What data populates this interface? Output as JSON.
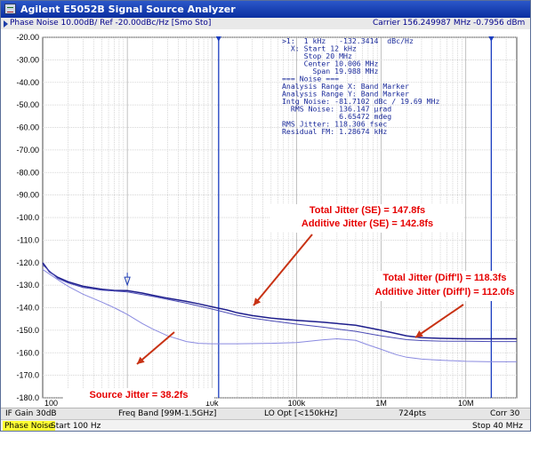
{
  "window": {
    "title": "Agilent E5052B Signal Source Analyzer"
  },
  "trace_header": {
    "label": "Phase Noise 10.00dB/ Ref -20.00dBc/Hz [Smo Sto]",
    "carrier": "Carrier 156.249987 MHz    -0.7956 dBm"
  },
  "marker_readout": [
    ">1:  1 kHz   -132.3414  dBc/Hz",
    "  X: Start 12 kHz",
    "     Stop 20 MHz",
    "     Center 10.006 MHz",
    "       Span 19.988 MHz",
    "=== Noise ===",
    "Analysis Range X: Band Marker",
    "Analysis Range Y: Band Marker",
    "Intg Noise: -81.7102 dBc / 19.69 MHz",
    "  RMS Noise: 136.147 µrad",
    "             6.65472 mdeg",
    "RMS Jitter: 118.306 fsec",
    "Residual FM: 1.28674 kHz"
  ],
  "annotations": {
    "se_1": "Total Jitter (SE) = 147.8fs",
    "se_2": "Additive Jitter (SE) = 142.8fs",
    "diff_1": "Total Jitter (Diff'l) = 118.3fs",
    "diff_2": "Additive Jitter (Diff'l) = 112.0fs",
    "source": "Source Jitter = 38.2fs"
  },
  "status_bar": {
    "if_gain": "IF Gain 30dB",
    "freq_band": "Freq Band [99M-1.5GHz]",
    "lo_opt": "LO Opt [<150kHz]",
    "points": "724pts",
    "corr": "Corr 30"
  },
  "meas_bar": {
    "measurement": "Phase Noise",
    "start": "Start 100 Hz",
    "stop": "Stop 40 MHz"
  },
  "colors": {
    "trace_total": "#1e1e8c",
    "trace_additive": "#4a4ab4",
    "trace_source": "#8a8ae0",
    "grid": "#c9c9c9",
    "arrow": "#c83214",
    "annotation_text": "#e60000",
    "marker": "#1e3cb4"
  },
  "chart_data": {
    "type": "line",
    "x_scale": "log",
    "xlim": [
      100,
      40000000
    ],
    "ylim": [
      -180,
      -20
    ],
    "x_ticks": [
      {
        "value": 100,
        "label": "100"
      },
      {
        "value": 10000,
        "label": "10k"
      },
      {
        "value": 100000,
        "label": "100k"
      },
      {
        "value": 1000000,
        "label": "1M"
      },
      {
        "value": 10000000,
        "label": "10M"
      }
    ],
    "y_ticks": [
      {
        "value": -20,
        "label": "-20.00"
      },
      {
        "value": -30,
        "label": "-30.00"
      },
      {
        "value": -40,
        "label": "-40.00"
      },
      {
        "value": -50,
        "label": "-50.00"
      },
      {
        "value": -60,
        "label": "-60.00"
      },
      {
        "value": -70,
        "label": "-70.00"
      },
      {
        "value": -80,
        "label": "-80.00"
      },
      {
        "value": -90,
        "label": "-90.00"
      },
      {
        "value": -100,
        "label": "-100.0"
      },
      {
        "value": -110,
        "label": "-110.0"
      },
      {
        "value": -120,
        "label": "-120.0"
      },
      {
        "value": -130,
        "label": "-130.0"
      },
      {
        "value": -140,
        "label": "-140.0"
      },
      {
        "value": -150,
        "label": "-150.0"
      },
      {
        "value": -160,
        "label": "-160.0"
      },
      {
        "value": -170,
        "label": "-170.0"
      },
      {
        "value": -180,
        "label": "-180.0"
      }
    ],
    "series": [
      {
        "x": [
          100,
          120,
          150,
          200,
          300,
          500,
          700,
          1000,
          1500,
          2000,
          3000,
          5000,
          7000,
          10000,
          15000,
          20000,
          30000,
          50000,
          100000,
          200000,
          300000,
          500000,
          1000000,
          2000000,
          3000000,
          5000000,
          10000000,
          20000000,
          40000000
        ],
        "y": [
          -120,
          -124,
          -126.5,
          -128.5,
          -130.5,
          -131.8,
          -132.3,
          -132.4,
          -133.5,
          -134.5,
          -135.8,
          -137.2,
          -138.3,
          -139.6,
          -141,
          -142.3,
          -143.5,
          -144.6,
          -145.6,
          -146.4,
          -147,
          -147.8,
          -150,
          -152.5,
          -153.3,
          -153.6,
          -153.8,
          -153.8,
          -153.8
        ]
      },
      {
        "x": [
          100,
          150,
          200,
          300,
          500,
          1000,
          2000,
          3000,
          5000,
          10000,
          20000,
          30000,
          50000,
          100000,
          200000,
          500000,
          1000000,
          2000000,
          3000000,
          5000000,
          10000000,
          20000000,
          40000000
        ],
        "y": [
          -121,
          -127,
          -129,
          -131,
          -132.2,
          -133,
          -135,
          -136.3,
          -138,
          -140.6,
          -143.4,
          -144.6,
          -145.8,
          -147.3,
          -148.6,
          -150.5,
          -152.5,
          -154.2,
          -154.6,
          -154.8,
          -154.9,
          -155,
          -155
        ]
      },
      {
        "x": [
          100,
          150,
          200,
          300,
          500,
          700,
          1000,
          1500,
          2000,
          3000,
          5000,
          7000,
          10000,
          20000,
          50000,
          100000,
          200000,
          300000,
          500000,
          700000,
          1000000,
          1500000,
          2000000,
          3000000,
          5000000,
          10000000,
          20000000,
          40000000
        ],
        "y": [
          -123,
          -127.5,
          -130.5,
          -134,
          -137.5,
          -140,
          -143,
          -147,
          -149.5,
          -152.5,
          -155,
          -155.8,
          -156,
          -156,
          -155.8,
          -155.5,
          -154.3,
          -153.8,
          -154.5,
          -156.5,
          -158.5,
          -160.8,
          -162,
          -162.8,
          -163.3,
          -163.8,
          -164,
          -164
        ]
      }
    ],
    "markers": [
      {
        "x": 1000,
        "y": -132.3414,
        "label": "1"
      }
    ]
  }
}
